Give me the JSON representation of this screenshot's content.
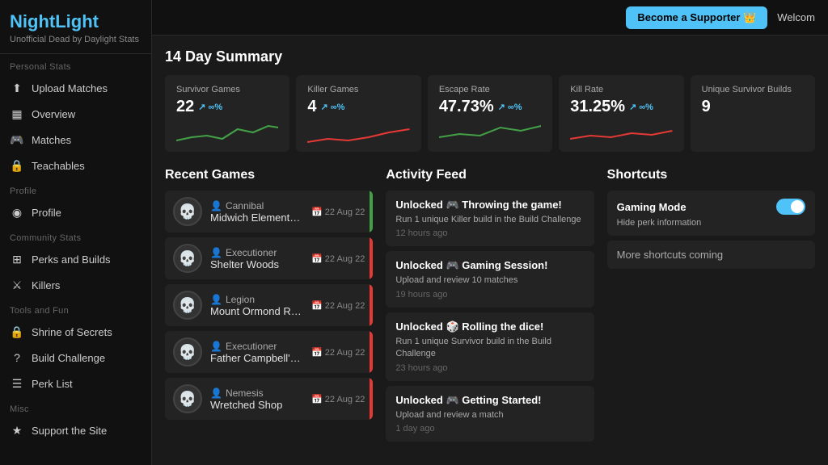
{
  "sidebar": {
    "logo_title_part1": "Night",
    "logo_title_part2": "Light",
    "logo_subtitle": "Unofficial Dead by Daylight Stats",
    "sections": [
      {
        "label": "Personal Stats",
        "items": [
          {
            "id": "upload-matches",
            "label": "Upload Matches",
            "icon": "⬆"
          },
          {
            "id": "overview",
            "label": "Overview",
            "icon": "▦"
          },
          {
            "id": "matches",
            "label": "Matches",
            "icon": "🎮"
          },
          {
            "id": "teachables",
            "label": "Teachables",
            "icon": "🔒"
          }
        ]
      },
      {
        "label": "Profile",
        "items": [
          {
            "id": "profile",
            "label": "Profile",
            "icon": "◉"
          }
        ]
      },
      {
        "label": "Community Stats",
        "items": [
          {
            "id": "perks-builds",
            "label": "Perks and Builds",
            "icon": "⊞"
          },
          {
            "id": "killers",
            "label": "Killers",
            "icon": "⚔"
          }
        ]
      },
      {
        "label": "Tools and Fun",
        "items": [
          {
            "id": "shrine",
            "label": "Shrine of Secrets",
            "icon": "🔒"
          },
          {
            "id": "build-challenge",
            "label": "Build Challenge",
            "icon": "?"
          },
          {
            "id": "perk-list",
            "label": "Perk List",
            "icon": "☰"
          }
        ]
      },
      {
        "label": "Misc",
        "items": [
          {
            "id": "support",
            "label": "Support the Site",
            "icon": "★"
          }
        ]
      }
    ]
  },
  "topbar": {
    "supporter_label": "Become a Supporter 👑",
    "welcome_label": "Welcom"
  },
  "summary": {
    "title": "14 Day Summary",
    "cards": [
      {
        "label": "Survivor Games",
        "value": "22",
        "trend": "↗ ∞%"
      },
      {
        "label": "Killer Games",
        "value": "4",
        "trend": "↗ ∞%"
      },
      {
        "label": "Escape Rate",
        "value": "47.73%",
        "trend": "↗ ∞%"
      },
      {
        "label": "Kill Rate",
        "value": "31.25%",
        "trend": "↗ ∞%"
      },
      {
        "label": "Unique Survivor Builds",
        "value": "9",
        "trend": ""
      }
    ]
  },
  "recent_games": {
    "title": "Recent Games",
    "items": [
      {
        "killer": "Cannibal",
        "map": "Midwich Elementary School",
        "date": "22 Aug 22",
        "result": "green",
        "icon": "💀"
      },
      {
        "killer": "Executioner",
        "map": "Shelter Woods",
        "date": "22 Aug 22",
        "result": "red",
        "icon": "💀"
      },
      {
        "killer": "Legion",
        "map": "Mount Ormond Resort",
        "date": "22 Aug 22",
        "result": "red",
        "icon": "💀"
      },
      {
        "killer": "Executioner",
        "map": "Father Campbell's Chapel",
        "date": "22 Aug 22",
        "result": "red",
        "icon": "💀"
      },
      {
        "killer": "Nemesis",
        "map": "Wretched Shop",
        "date": "22 Aug 22",
        "result": "red",
        "icon": "💀"
      }
    ]
  },
  "activity_feed": {
    "title": "Activity Feed",
    "items": [
      {
        "title": "Unlocked 🎮 Throwing the game!",
        "desc": "Run 1 unique Killer build in the Build Challenge",
        "time": "12 hours ago"
      },
      {
        "title": "Unlocked 🎮 Gaming Session!",
        "desc": "Upload and review 10 matches",
        "time": "19 hours ago"
      },
      {
        "title": "Unlocked 🎲 Rolling the dice!",
        "desc": "Run 1 unique Survivor build in the Build Challenge",
        "time": "23 hours ago"
      },
      {
        "title": "Unlocked 🎮 Getting Started!",
        "desc": "Upload and review a match",
        "time": "1 day ago"
      }
    ]
  },
  "shortcuts": {
    "title": "Shortcuts",
    "gaming_mode_label": "Gaming Mode",
    "hide_perk_label": "Hide perk information",
    "more_label": "More shortcuts coming"
  }
}
